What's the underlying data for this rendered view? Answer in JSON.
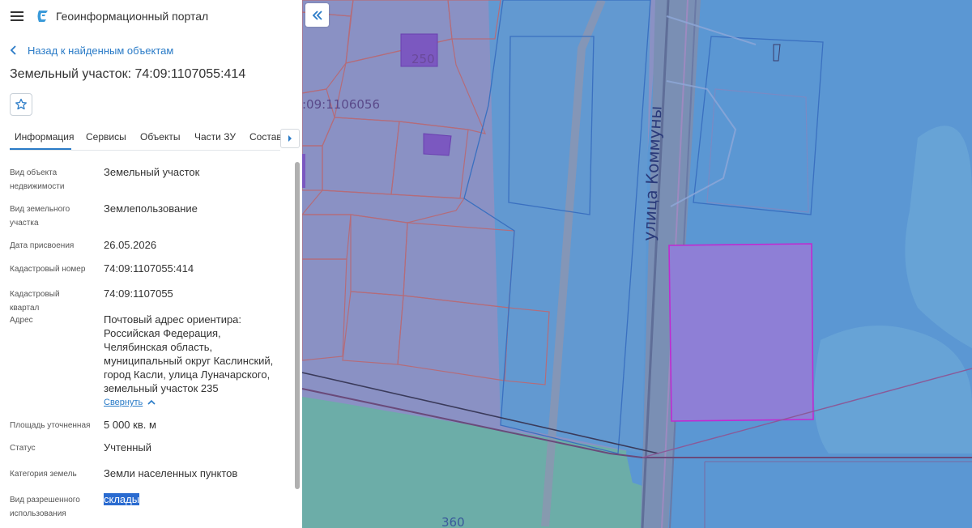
{
  "header": {
    "title": "Геоинформационный портал",
    "menu_icon": "menu-icon",
    "logo_icon": "logo-icon"
  },
  "back_link": {
    "label": "Назад к найденным объектам",
    "icon": "chevron-left-icon"
  },
  "object_title": "Земельный участок: 74:09:1107055:414",
  "favorite_icon": "star-icon",
  "tabs": [
    {
      "label": "Информация",
      "active": true
    },
    {
      "label": "Сервисы"
    },
    {
      "label": "Объекты"
    },
    {
      "label": "Части ЗУ"
    },
    {
      "label": "Состав"
    }
  ],
  "tabs_next_icon": "caret-right-icon",
  "properties": [
    {
      "label": "Вид объекта недвижимости",
      "value": "Земельный участок"
    },
    {
      "label": "Вид земельного участка",
      "value": "Землепользование"
    },
    {
      "label": "Дата присвоения",
      "value": "26.05.2026"
    },
    {
      "label": "Кадастровый номер",
      "value": "74:09:1107055:414"
    },
    {
      "label": "Кадастровый квартал",
      "value": "74:09:1107055"
    },
    {
      "label": "Адрес",
      "value": "Почтовый адрес ориентира: Российская Федерация, Челябинская область, муниципальный округ Каслинский, город Касли, улица Луначарского, земельный участок 235"
    },
    {
      "label": "Площадь уточненная",
      "value": "5 000 кв. м"
    },
    {
      "label": "Статус",
      "value": "Учтенный"
    },
    {
      "label": "Категория земель",
      "value": "Земли населенных пунктов"
    },
    {
      "label": "Вид разрешенного использования",
      "value": "склады"
    }
  ],
  "collapse_label": "Свернуть",
  "collapse_icon": "chevron-up-icon",
  "map": {
    "street_label": "улица Коммуны",
    "quarter_label": ":09:1106056",
    "label_250": "250",
    "label_360": "360",
    "collapse_panel_icon": "double-chevron-left-icon"
  },
  "colors": {
    "accent": "#2a7bc7",
    "map_water": "#5b97d3",
    "selected_parcel": "#8e7fd6"
  }
}
